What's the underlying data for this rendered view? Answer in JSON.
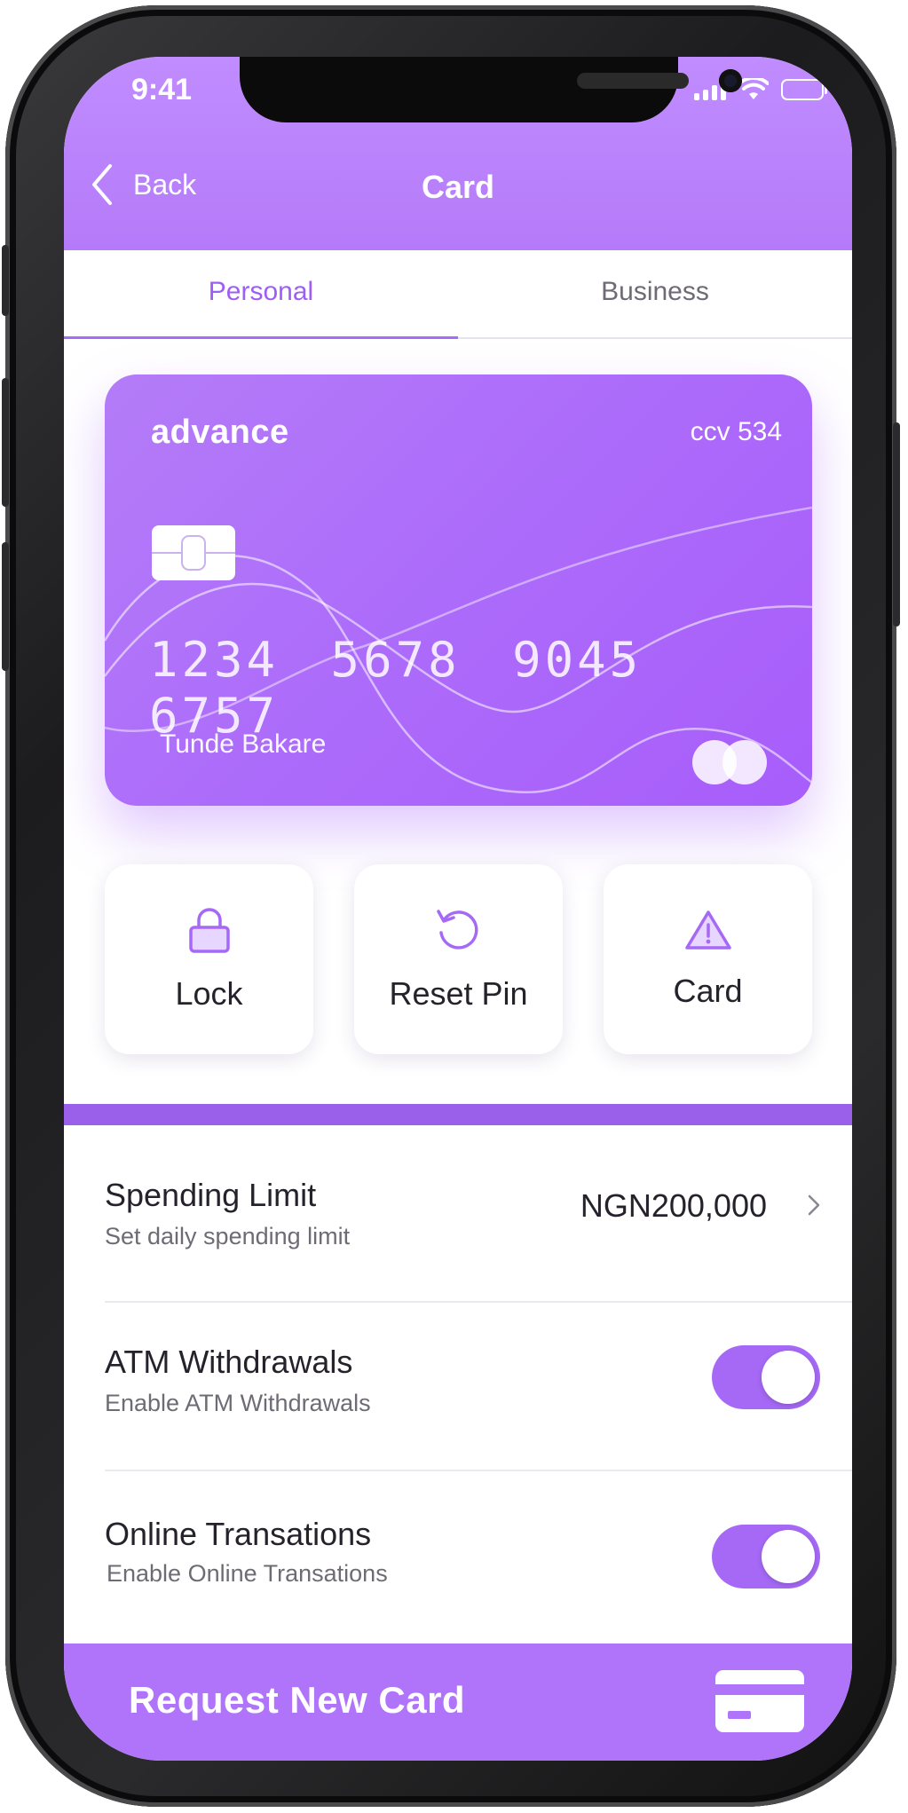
{
  "status_bar": {
    "time": "9:41"
  },
  "header": {
    "back_label": "Back",
    "title": "Card"
  },
  "tabs": [
    {
      "label": "Personal",
      "active": true
    },
    {
      "label": "Business",
      "active": false
    }
  ],
  "card": {
    "brand": "advance",
    "ccv": "ccv 534",
    "number": "1234 5678 9045 6757",
    "holder": "Tunde Bakare"
  },
  "actions": [
    {
      "label": "Lock",
      "icon": "lock-icon"
    },
    {
      "label": "Reset Pin",
      "icon": "reset-icon"
    },
    {
      "label": "Card",
      "icon": "warning-icon"
    }
  ],
  "settings": {
    "spending_limit": {
      "title": "Spending Limit",
      "subtitle": "Set daily spending limit",
      "value": "NGN200,000"
    },
    "atm": {
      "title": "ATM Withdrawals",
      "subtitle": "Enable ATM Withdrawals",
      "enabled": true
    },
    "online": {
      "title": "Online Transations",
      "subtitle": "Enable Online Transations",
      "enabled": true
    }
  },
  "bottom_bar": {
    "label": "Request New Card"
  },
  "colors": {
    "accent": "#a569f5",
    "header": "#b57af9",
    "text": "#26222c",
    "muted": "#6f6b75"
  }
}
